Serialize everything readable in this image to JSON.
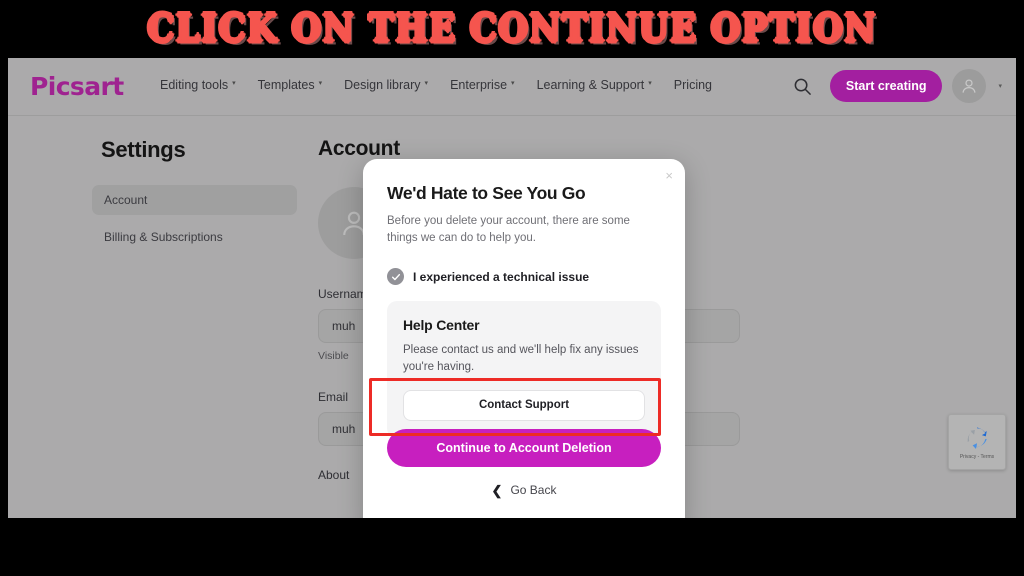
{
  "annotation": {
    "banner_text": "CLICK ON THE CONTINUE OPTION",
    "banner_color": "#f5554e",
    "highlight_color": "#ed2b26"
  },
  "header": {
    "logo": "Picsart",
    "nav": [
      {
        "label": "Editing tools",
        "has_caret": true
      },
      {
        "label": "Templates",
        "has_caret": true
      },
      {
        "label": "Design library",
        "has_caret": true
      },
      {
        "label": "Enterprise",
        "has_caret": true
      },
      {
        "label": "Learning & Support",
        "has_caret": true
      },
      {
        "label": "Pricing",
        "has_caret": false
      }
    ],
    "caret": "▾",
    "search_icon": "search-icon",
    "cta_label": "Start creating",
    "cta_color": "#a31fa0",
    "avatar_icon": "user-avatar-icon",
    "avatar_caret": "▾"
  },
  "sidebar": {
    "title": "Settings",
    "items": [
      {
        "label": "Account",
        "active": true
      },
      {
        "label": "Billing & Subscriptions",
        "active": false
      }
    ]
  },
  "content": {
    "title": "Account",
    "avatar_icon": "profile-placeholder-icon",
    "fields": [
      {
        "label": "Username",
        "value": "muh",
        "help": "Visible"
      },
      {
        "label": "Email",
        "value": "muh",
        "help": ""
      }
    ],
    "about_label": "About"
  },
  "recaptcha": {
    "logo_icon": "recaptcha-icon",
    "label": "Privacy - Terms"
  },
  "modal": {
    "close_icon": "×",
    "title": "We'd Hate to See You Go",
    "subtitle": "Before you delete your account, there are some things we can do to help you.",
    "reason": {
      "label": "I experienced a technical issue",
      "checked": true,
      "check_glyph": "✓"
    },
    "help_card": {
      "title": "Help Center",
      "text": "Please contact us and we'll help fix any issues you're having.",
      "button_label": "Contact Support"
    },
    "primary_button": {
      "label": "Continue to Account Deletion",
      "color": "#c71fbf"
    },
    "back_link": {
      "chevron": "❮",
      "label": "Go Back"
    }
  }
}
